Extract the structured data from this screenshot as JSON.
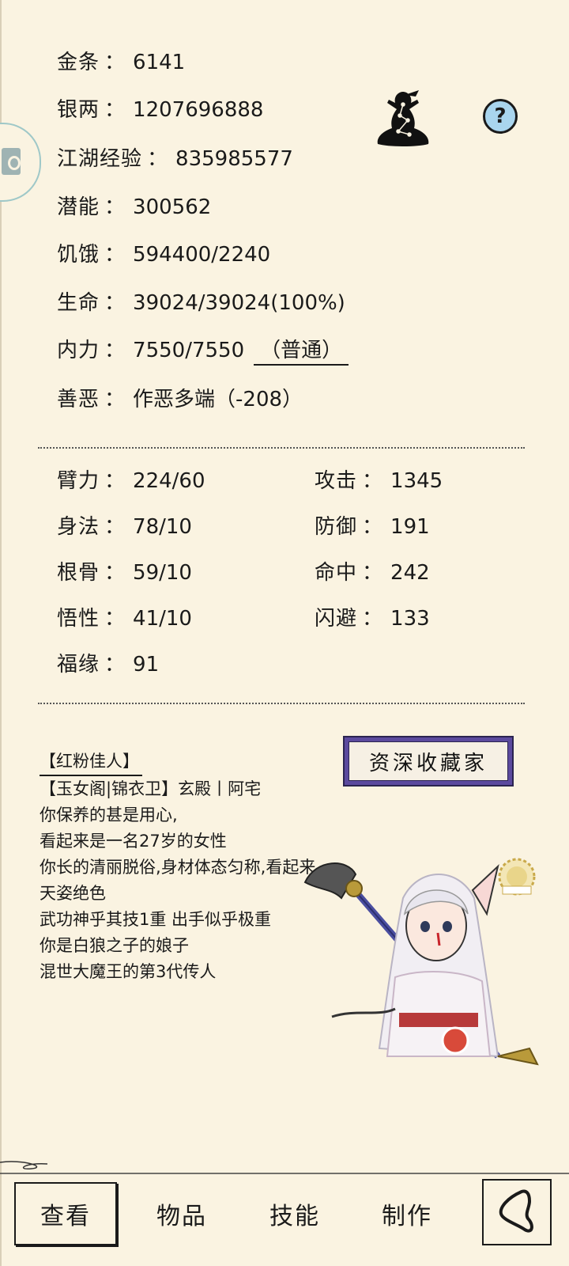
{
  "stats": {
    "gold": {
      "label": "金条",
      "value": "6141"
    },
    "silver": {
      "label": "银两",
      "value": "1207696888"
    },
    "exp": {
      "label": "江湖经验",
      "value": "835985577"
    },
    "potential": {
      "label": "潜能",
      "value": "300562"
    },
    "hunger": {
      "label": "饥饿",
      "value": "594400/2240"
    },
    "life": {
      "label": "生命",
      "value": "39024/39024(100%)"
    },
    "internal": {
      "label": "内力",
      "value": "7550/7550",
      "mode": "（普通）"
    },
    "morality": {
      "label": "善恶",
      "value": "作恶多端（-208）"
    }
  },
  "colon": "：",
  "attributes": {
    "strength": {
      "label": "臂力",
      "value": "224/60"
    },
    "agility": {
      "label": "身法",
      "value": "78/10"
    },
    "constitution": {
      "label": "根骨",
      "value": "59/10"
    },
    "insight": {
      "label": "悟性",
      "value": "41/10"
    },
    "luck": {
      "label": "福缘",
      "value": "91"
    }
  },
  "combat": {
    "attack": {
      "label": "攻击",
      "value": "1345"
    },
    "defense": {
      "label": "防御",
      "value": "191"
    },
    "accuracy": {
      "label": "命中",
      "value": "242"
    },
    "dodge": {
      "label": "闪避",
      "value": "133"
    }
  },
  "profile": {
    "title": "【红粉佳人】",
    "badge": "资深收藏家",
    "lines": [
      "【玉女阁|锦衣卫】玄殿丨阿宅",
      "你保养的甚是用心,",
      "看起来是一名27岁的女性",
      "你长的清丽脱俗,身材体态匀称,看起来天姿绝色",
      "武功神乎其技1重 出手似乎极重",
      "你是白狼之子的娘子",
      "混世大魔王的第3代传人"
    ]
  },
  "nav": {
    "tabs": [
      "查看",
      "物品",
      "技能",
      "制作"
    ],
    "active": 0
  },
  "icons": {
    "help": "help-icon",
    "meditation": "meditation-avatar-icon",
    "back": "back-icon"
  },
  "colors": {
    "background": "#faf3e1",
    "help_icon": "#a9d5ee",
    "title_badge": "#5b4a9e"
  }
}
